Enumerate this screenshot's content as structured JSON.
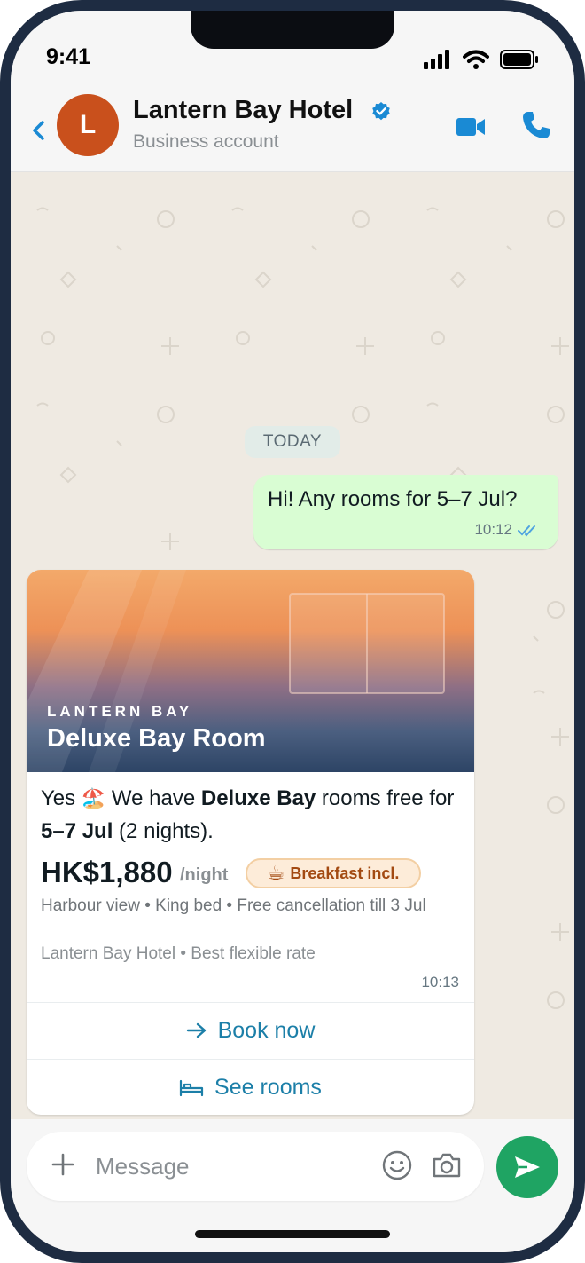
{
  "status_bar": {
    "time": "9:41"
  },
  "header": {
    "avatar_letter": "L",
    "name": "Lantern Bay Hotel",
    "subtitle": "Business account"
  },
  "chat": {
    "date_label": "TODAY",
    "outgoing": {
      "text": "Hi! Any rooms for 5–7 Jul?",
      "time": "10:12"
    },
    "incoming": {
      "hero_brand": "LANTERN BAY",
      "hero_title": "Deluxe Bay Room",
      "text_1": "Yes ",
      "emoji": "🏖️",
      "text_2": " We have ",
      "bold_1": "Deluxe Bay",
      "text_3": " rooms free for ",
      "bold_2": "5–7 Jul",
      "text_4": " (2 nights).",
      "price": "HK$1,880",
      "per_night": "/night",
      "badge_icon": "☕",
      "badge_label": "Breakfast incl.",
      "features": "Harbour view • King bed • Free cancellation till 3 Jul",
      "rate": "Lantern Bay Hotel • Best flexible rate",
      "time": "10:13",
      "buttons": [
        {
          "label": "Book now",
          "icon": "arrow-right-icon"
        },
        {
          "label": "See rooms",
          "icon": "bed-icon"
        }
      ]
    }
  },
  "composer": {
    "placeholder": "Message"
  },
  "colors": {
    "accent_blue": "#1a8ad4",
    "outgoing_bubble": "#d9fdd3",
    "send_green": "#1fa463",
    "avatar": "#c9501c",
    "link_blue": "#1c7fa8"
  }
}
